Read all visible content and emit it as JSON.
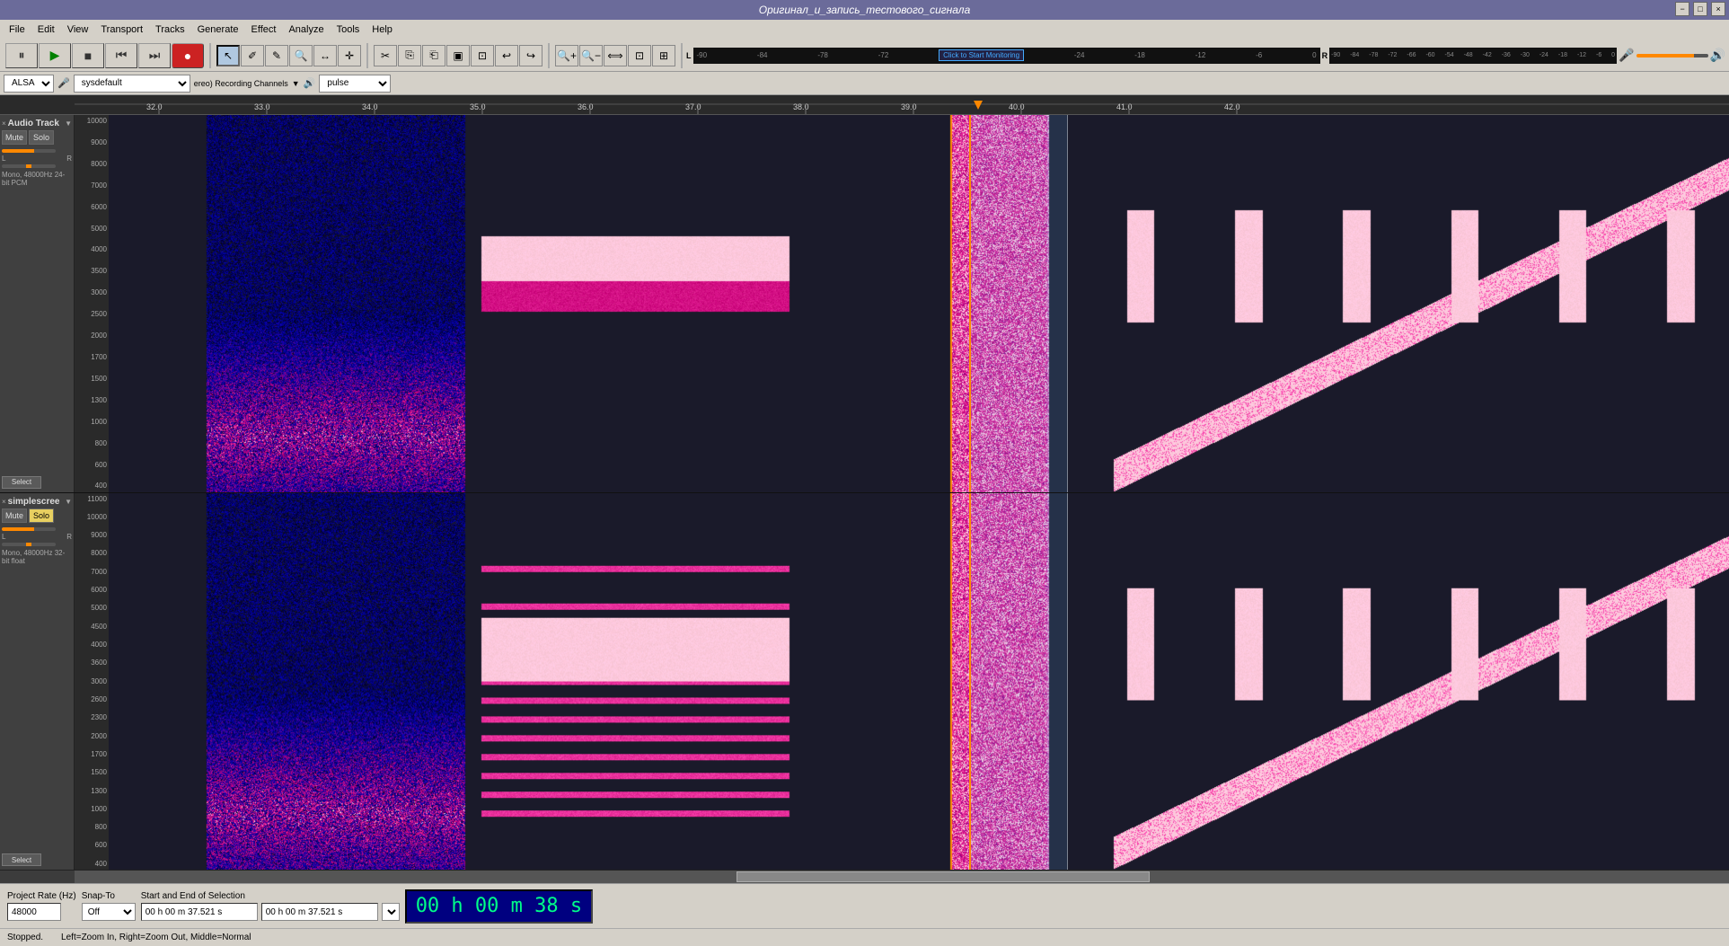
{
  "title": "Оригинал_и_запись_тестового_сигнала",
  "menu": {
    "items": [
      "File",
      "Edit",
      "View",
      "Transport",
      "Tracks",
      "Generate",
      "Effect",
      "Analyze",
      "Tools",
      "Help"
    ]
  },
  "titleButtons": [
    "−",
    "□",
    "×"
  ],
  "transport": {
    "pause_label": "⏸",
    "play_label": "▶",
    "stop_label": "■",
    "prev_label": "⏮",
    "next_label": "⏭",
    "record_label": "●"
  },
  "toolbar": {
    "tools": [
      "↖",
      "✂",
      "◻",
      "🖊",
      "🔍",
      "Z",
      "↕",
      "✎",
      "∿",
      "⊕",
      "⊕"
    ],
    "zoom_in": "+",
    "zoom_out": "−",
    "zoom_sel": "↔",
    "zoom_fit": "⊡",
    "zoom_full": "⊞"
  },
  "deviceBar": {
    "api_label": "ALSA",
    "mic_icon": "🎤",
    "input_device": "sysdefault",
    "channels": "ereo) Recording Channels",
    "speaker_icon": "🔊",
    "output_device": "pulse"
  },
  "timeRuler": {
    "ticks": [
      "32.0",
      "33.0",
      "34.0",
      "35.0",
      "36.0",
      "37.0",
      "38.0",
      "39.0",
      "40.0",
      "41.0",
      "42.0"
    ]
  },
  "tracks": [
    {
      "id": "track1",
      "name": "Audio Track",
      "mute": false,
      "solo": false,
      "info": "Mono, 48000Hz\n24-bit PCM",
      "select_label": "Select"
    },
    {
      "id": "track2",
      "name": "simplescree",
      "mute": false,
      "solo": true,
      "info": "Mono, 48000Hz\n32-bit float",
      "select_label": "Select"
    }
  ],
  "statusBar": {
    "project_rate_label": "Project Rate (Hz)",
    "project_rate_value": "48000",
    "snap_label": "Snap-To",
    "snap_value": "Off",
    "selection_label": "Start and End of Selection",
    "selection_start": "00 h 00 m 37.521 s",
    "selection_end": "00 h 00 m 37.521 s",
    "time_display": "00 h 00 m 38 s"
  },
  "statusText": {
    "left_text": "Stopped.",
    "hint_text": "Left=Zoom In, Right=Zoom Out, Middle=Normal"
  },
  "meters": {
    "input_labels": [
      "-90",
      "-84",
      "-78",
      "-72",
      "Click to Start Monitoring",
      "-24",
      "-18",
      "-12",
      "-6",
      "0"
    ],
    "output_labels": [
      "-90",
      "-84",
      "-78",
      "-72",
      "-66",
      "-60",
      "-54",
      "-48",
      "-42",
      "-36",
      "-30",
      "-24",
      "-18",
      "-12",
      "-6",
      "0"
    ]
  },
  "playhead_position_pct": 52,
  "selection_start_pct": 52,
  "selection_end_pct": 58,
  "colors": {
    "bg_dark": "#1a1a2e",
    "bg_track": "#2a2a3a",
    "selection": "rgba(100,180,255,0.2)",
    "playhead": "#ff8c00",
    "spectrogram_hot": "#ff1493",
    "spectrogram_mid": "#4169e1",
    "spectrogram_cool": "#00ced1"
  }
}
